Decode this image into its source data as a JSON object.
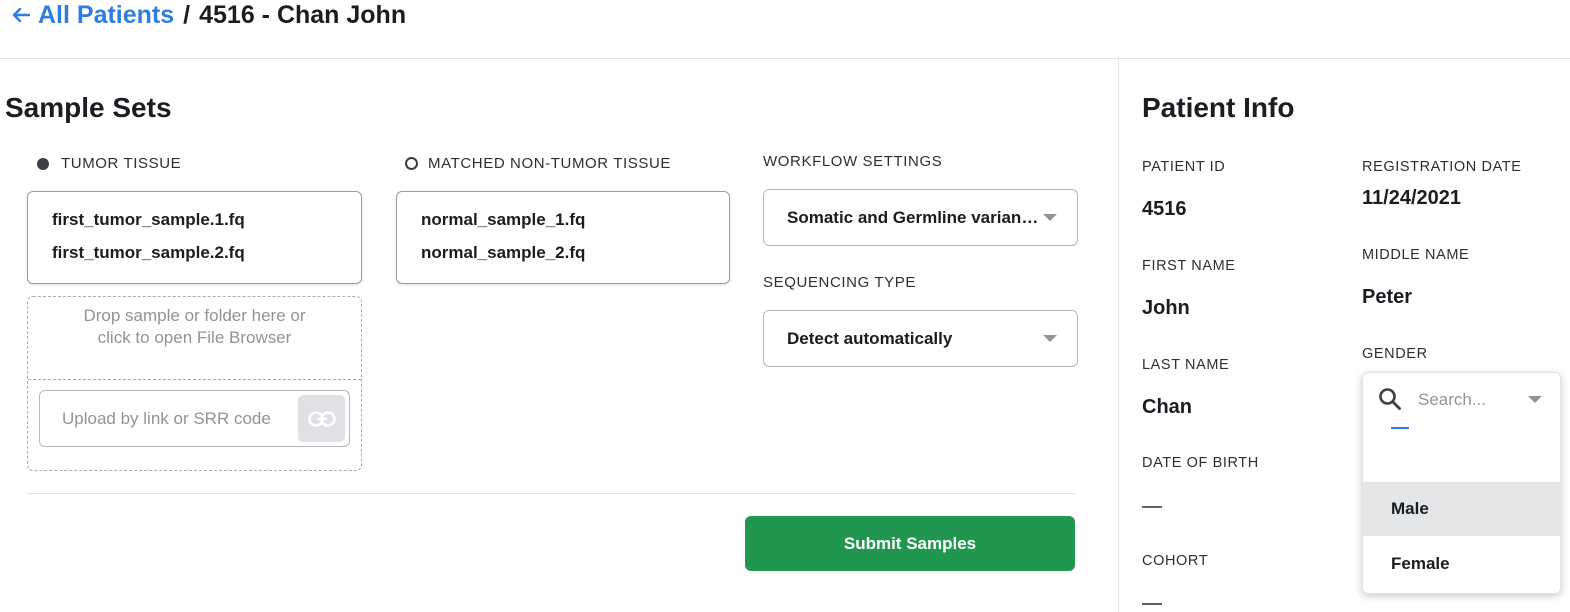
{
  "breadcrumb": {
    "back_label": "All Patients",
    "separator": "/",
    "current": "4516 - Chan John"
  },
  "sample_sets": {
    "title": "Sample Sets",
    "tumor": {
      "label": "TUMOR TISSUE",
      "files": [
        "first_tumor_sample.1.fq",
        "first_tumor_sample.2.fq"
      ]
    },
    "normal": {
      "label": "MATCHED NON-TUMOR TISSUE",
      "files": [
        "normal_sample_1.fq",
        "normal_sample_2.fq"
      ]
    },
    "drop_zone": {
      "text": "Drop sample or folder here or click to open File Browser",
      "link_placeholder": "Upload by link or SRR code"
    },
    "workflow": {
      "label": "WORKFLOW SETTINGS",
      "value": "Somatic and Germline variant calling"
    },
    "sequencing": {
      "label": "SEQUENCING TYPE",
      "value": "Detect automatically"
    },
    "submit_label": "Submit Samples"
  },
  "patient_info": {
    "title": "Patient Info",
    "patient_id": {
      "label": "PATIENT ID",
      "value": "4516"
    },
    "registration_date": {
      "label": "REGISTRATION DATE",
      "value": "11/24/2021"
    },
    "first_name": {
      "label": "FIRST NAME",
      "value": "John"
    },
    "middle_name": {
      "label": "MIDDLE NAME",
      "value": "Peter"
    },
    "last_name": {
      "label": "LAST NAME",
      "value": "Chan"
    },
    "gender": {
      "label": "GENDER",
      "search_placeholder": "Search...",
      "options": [
        "—",
        "Male",
        "Female"
      ],
      "highlighted": "Male"
    },
    "date_of_birth": {
      "label": "DATE OF BIRTH",
      "value": "—"
    },
    "cohort": {
      "label": "COHORT",
      "value": "—"
    }
  },
  "icons": {
    "back": "arrow-left-icon",
    "link": "link-icon",
    "search": "search-icon",
    "caret": "chevron-down-icon"
  },
  "colors": {
    "accent": "#2f7de1",
    "submit": "#21964f"
  }
}
